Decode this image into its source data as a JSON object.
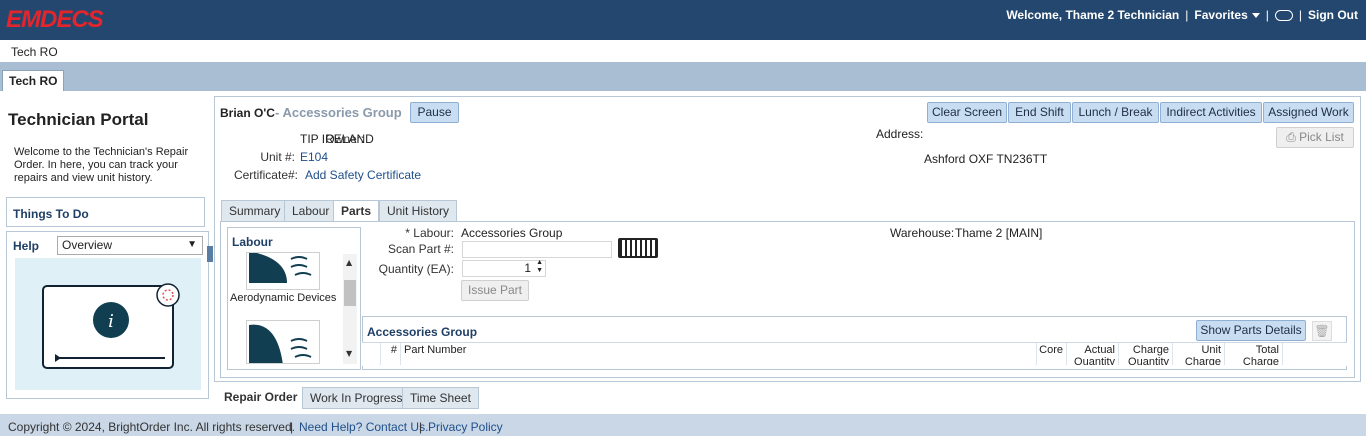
{
  "brand": {
    "logo": "EMDECS"
  },
  "topnav": {
    "welcome": "Welcome, Thame 2 Technician",
    "favorites": "Favorites",
    "sign_out": "Sign Out",
    "sep": "|"
  },
  "breadcrumb": "Tech RO",
  "main_tab": "Tech RO",
  "left": {
    "title": "Technician Portal",
    "description": "Welcome to the Technician's Repair Order. In here, you can track your repairs and view unit history.",
    "things_to_do": "Things To Do",
    "help_label": "Help",
    "help_selected": "Overview"
  },
  "header": {
    "name": "Brian O'C",
    "group": "- Accessories Group",
    "pause": "Pause",
    "actions": [
      "Clear Screen",
      "End Shift",
      "Lunch / Break",
      "Indirect Activities",
      "Assigned Work"
    ],
    "pick_list": "Pick List"
  },
  "info": {
    "owner_label": "Owner:",
    "owner_value": "TIP IRELAND",
    "unit_label": "Unit #:",
    "unit_value": "E104",
    "cert_label": "Certificate#:",
    "cert_value": "Add Safety Certificate",
    "address_label": "Address:",
    "address_value": "Ashford OXF TN236TT"
  },
  "subtabs": [
    "Summary",
    "Labour",
    "Parts",
    "Unit History"
  ],
  "active_subtab": "Parts",
  "labour_list": {
    "title": "Labour",
    "items": [
      "Aerodynamic Devices"
    ]
  },
  "parts_form": {
    "labour_label": "* Labour:",
    "labour_value": "Accessories Group",
    "scan_label": "Scan Part #:",
    "scan_value": "",
    "qty_label": "Quantity (EA):",
    "qty_value": "1",
    "issue_button": "Issue Part",
    "warehouse_label": "Warehouse:",
    "warehouse_value": "Thame 2 [MAIN]"
  },
  "grid": {
    "title": "Accessories Group",
    "show_details": "Show Parts Details",
    "columns": [
      "#",
      "Part Number",
      "Core",
      "Actual Quantity",
      "Charge Quantity",
      "Unit Charge",
      "Total Charge"
    ]
  },
  "bottom_tabs": [
    "Repair Order",
    "Work In Progress",
    "Time Sheet"
  ],
  "active_bottom_tab": "Repair Order",
  "footer": {
    "copyright": "Copyright © 2024, BrightOrder Inc. All rights reserved.",
    "help": "Need Help? Contact Us.",
    "privacy": "Privacy Policy",
    "sep": "|"
  },
  "colors": {
    "topbar": "#23476e",
    "logo": "#e4252b",
    "button": "#c9ddf2",
    "accent_text": "#1f3f66"
  },
  "icons": {
    "chat": "chat-bubble-icon",
    "printer": "printer-icon",
    "keyboard": "keyboard-icon",
    "trash": "trash-icon",
    "help_info": "info-icon"
  }
}
